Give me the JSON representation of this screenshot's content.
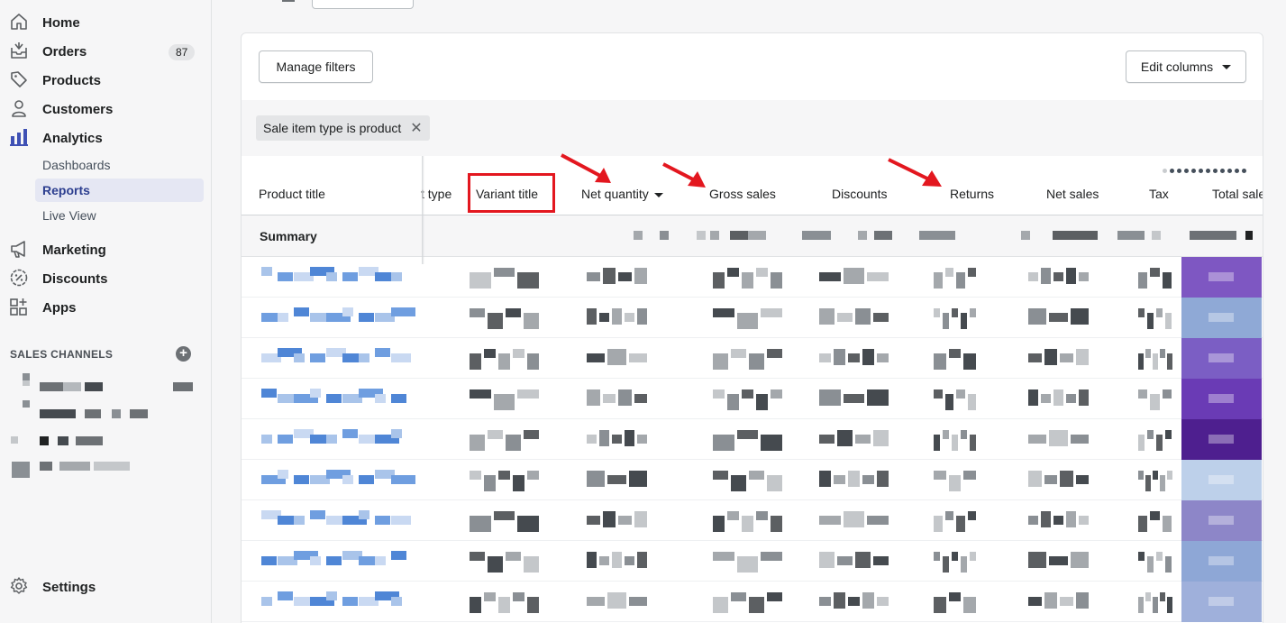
{
  "sidebar": {
    "nav": [
      {
        "label": "Home",
        "icon": "home-icon"
      },
      {
        "label": "Orders",
        "icon": "orders-icon",
        "badge": "87"
      },
      {
        "label": "Products",
        "icon": "tag-icon"
      },
      {
        "label": "Customers",
        "icon": "person-icon"
      },
      {
        "label": "Analytics",
        "icon": "bar-chart-icon"
      }
    ],
    "analytics_sub": [
      {
        "label": "Dashboards"
      },
      {
        "label": "Reports",
        "active": true
      },
      {
        "label": "Live View"
      }
    ],
    "nav2": [
      {
        "label": "Marketing",
        "icon": "megaphone-icon"
      },
      {
        "label": "Discounts",
        "icon": "discount-icon"
      },
      {
        "label": "Apps",
        "icon": "apps-icon"
      }
    ],
    "sales_channels_title": "SALES CHANNELS",
    "settings_label": "Settings"
  },
  "report": {
    "manage_filters_label": "Manage filters",
    "edit_columns_label": "Edit columns",
    "filter_chip": "Sale item type is product",
    "columns": [
      "Product title",
      "t type",
      "Variant title",
      "Net quantity",
      "Gross sales",
      "Discounts",
      "Returns",
      "Net sales",
      "Tax",
      "Total sale"
    ],
    "summary_label": "Summary"
  },
  "colors": {
    "accent": "#5c6ac4",
    "annotation_red": "#e3171f",
    "total_column_shades": [
      "#7e57c2",
      "#8fa9d6",
      "#7b5ec4",
      "#6a3bb5",
      "#4e1f8f",
      "#bdd0ea",
      "#8d86c8",
      "#8ea7d6",
      "#9fb0db"
    ]
  }
}
